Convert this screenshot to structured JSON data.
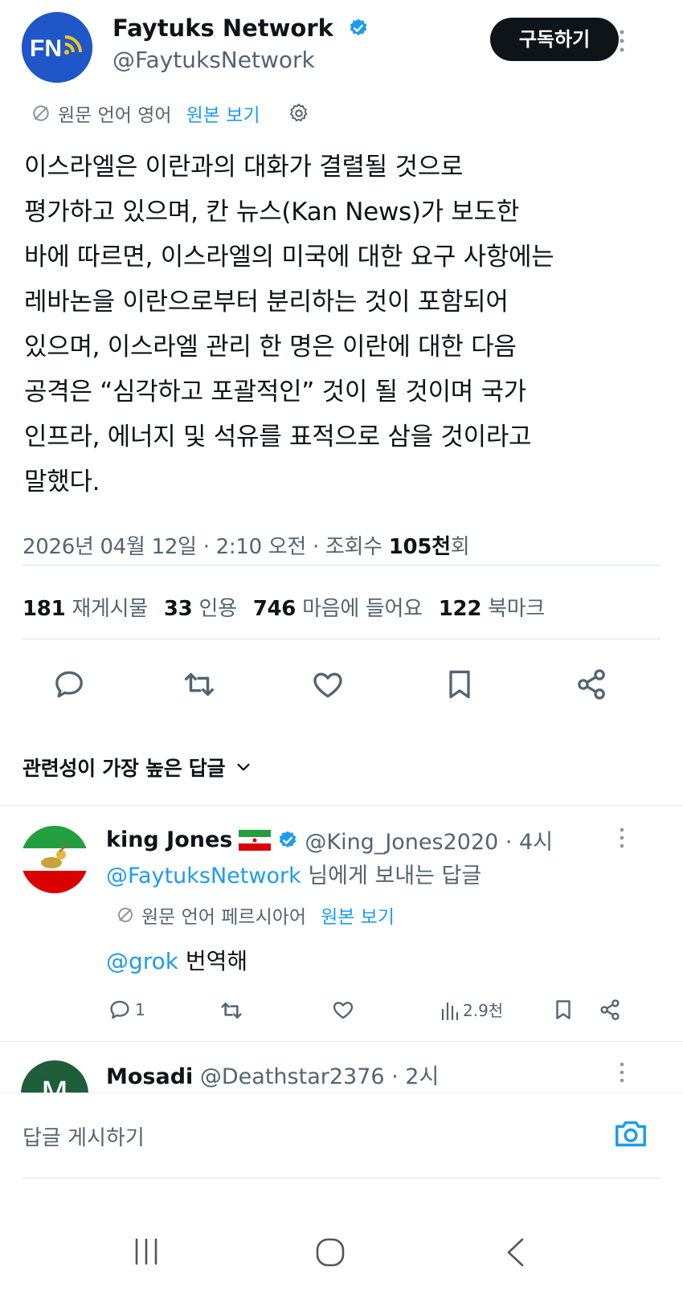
{
  "account": {
    "name": "Faytuks Network",
    "handle": "@FaytuksNetwork",
    "avatar_text": "FN",
    "subscribe_label": "구독하기"
  },
  "translation": {
    "note": "원문 언어 영어",
    "show_original": "원본 보기"
  },
  "tweet": {
    "text": "이스라엘은 이란과의 대화가 결렬될 것으로\n평가하고 있으며, 칸 뉴스(Kan News)가 보도한\n바에 따르면, 이스라엘의 미국에 대한 요구 사항에는\n레바논을 이란으로부터 분리하는 것이 포함되어\n있으며, 이스라엘 관리 한 명은 이란에 대한 다음\n공격은 “심각하고 포괄적인” 것이 될 것이며 국가\n인프라, 에너지 및 석유를 표적으로 삼을 것이라고\n말했다.",
    "date": "2026년 04월 12일 · 2:10 오전 · 조회수 ",
    "views_number": "105천",
    "views_suffix": "회"
  },
  "stats": [
    {
      "value": "181",
      "label": "재게시물"
    },
    {
      "value": "33",
      "label": "인용"
    },
    {
      "value": "746",
      "label": "마음에 들어요"
    },
    {
      "value": "122",
      "label": "북마크"
    }
  ],
  "sort": {
    "label": "관련성이 가장 높은 답글"
  },
  "replies": [
    {
      "name": "king Jones",
      "handle": "@King_Jones2020 · 4시",
      "reply_to_handle": "@FaytuksNetwork",
      "reply_to_suffix": " 님에게 보내는 답글",
      "translation_note": "원문 언어 페르시아어",
      "show_original": "원본 보기",
      "mention": "@grok",
      "text": " 번역해",
      "reply_count": "1",
      "views": "2.9천"
    },
    {
      "name": "Mosadi",
      "handle": "@Deathstar2376 · 2시",
      "avatar_letter": "M"
    }
  ],
  "composer": {
    "placeholder": "답글 게시하기"
  },
  "colors": {
    "accent": "#1d9bf0",
    "text": "#0f1419",
    "muted": "#536471"
  }
}
